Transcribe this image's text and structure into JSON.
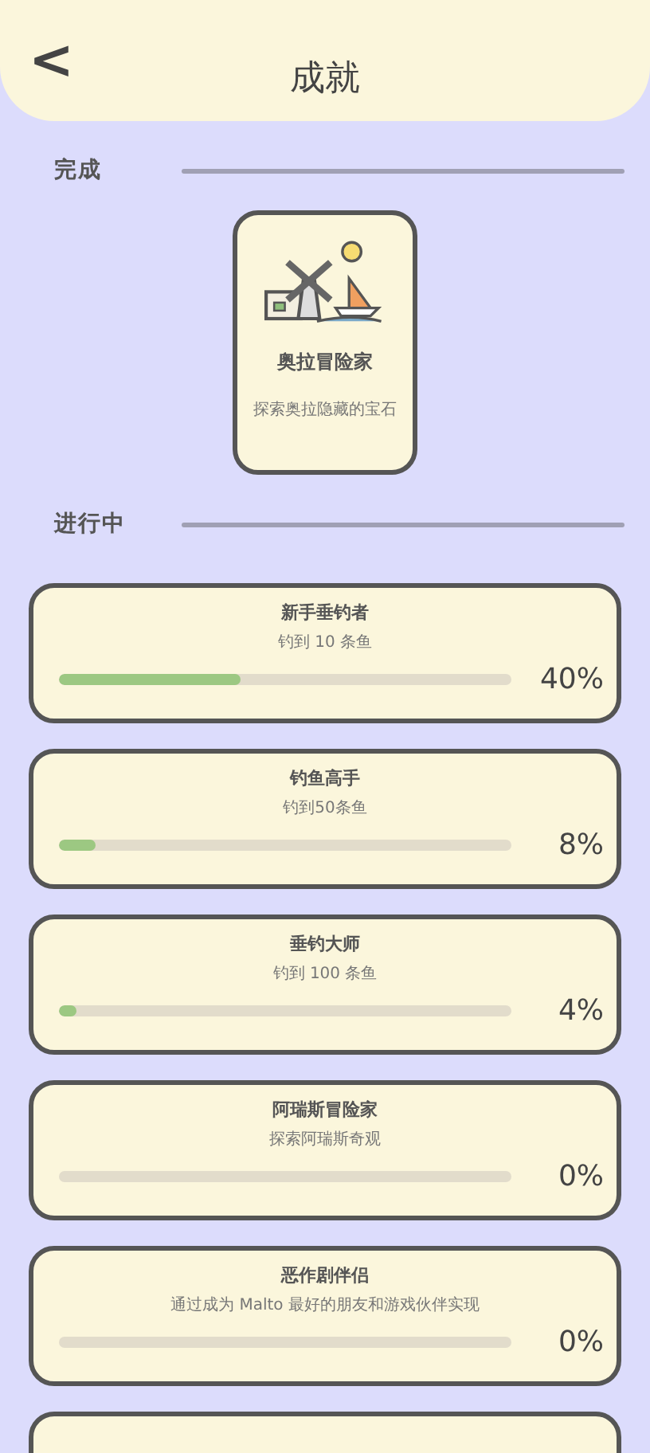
{
  "header": {
    "back": "<",
    "title": "成就"
  },
  "completed": {
    "heading": "完成",
    "items": [
      {
        "kind": "picture",
        "title": "奥拉冒险家",
        "description": "探索奥拉隐藏的宝石"
      }
    ]
  },
  "in_progress": {
    "heading": "进行中",
    "items": [
      {
        "title": "新手垂钓者",
        "description": "钓到 10 条鱼",
        "level": 0.4,
        "percent": "40%"
      },
      {
        "title": "钓鱼高手",
        "description": "钓到50条鱼",
        "level": 0.08,
        "percent": "8%"
      },
      {
        "title": "垂钓大师",
        "description": "钓到 100 条鱼",
        "level": 0.04,
        "percent": "4%"
      },
      {
        "title": "阿瑞斯冒险家",
        "description": "探索阿瑞斯奇观",
        "percent": "0%"
      },
      {
        "title": "恶作剧伴侣",
        "description": "通过成为 Malto 最好的朋友和游戏伙伴实现",
        "percent": "0%"
      }
    ],
    "more_below": true
  }
}
